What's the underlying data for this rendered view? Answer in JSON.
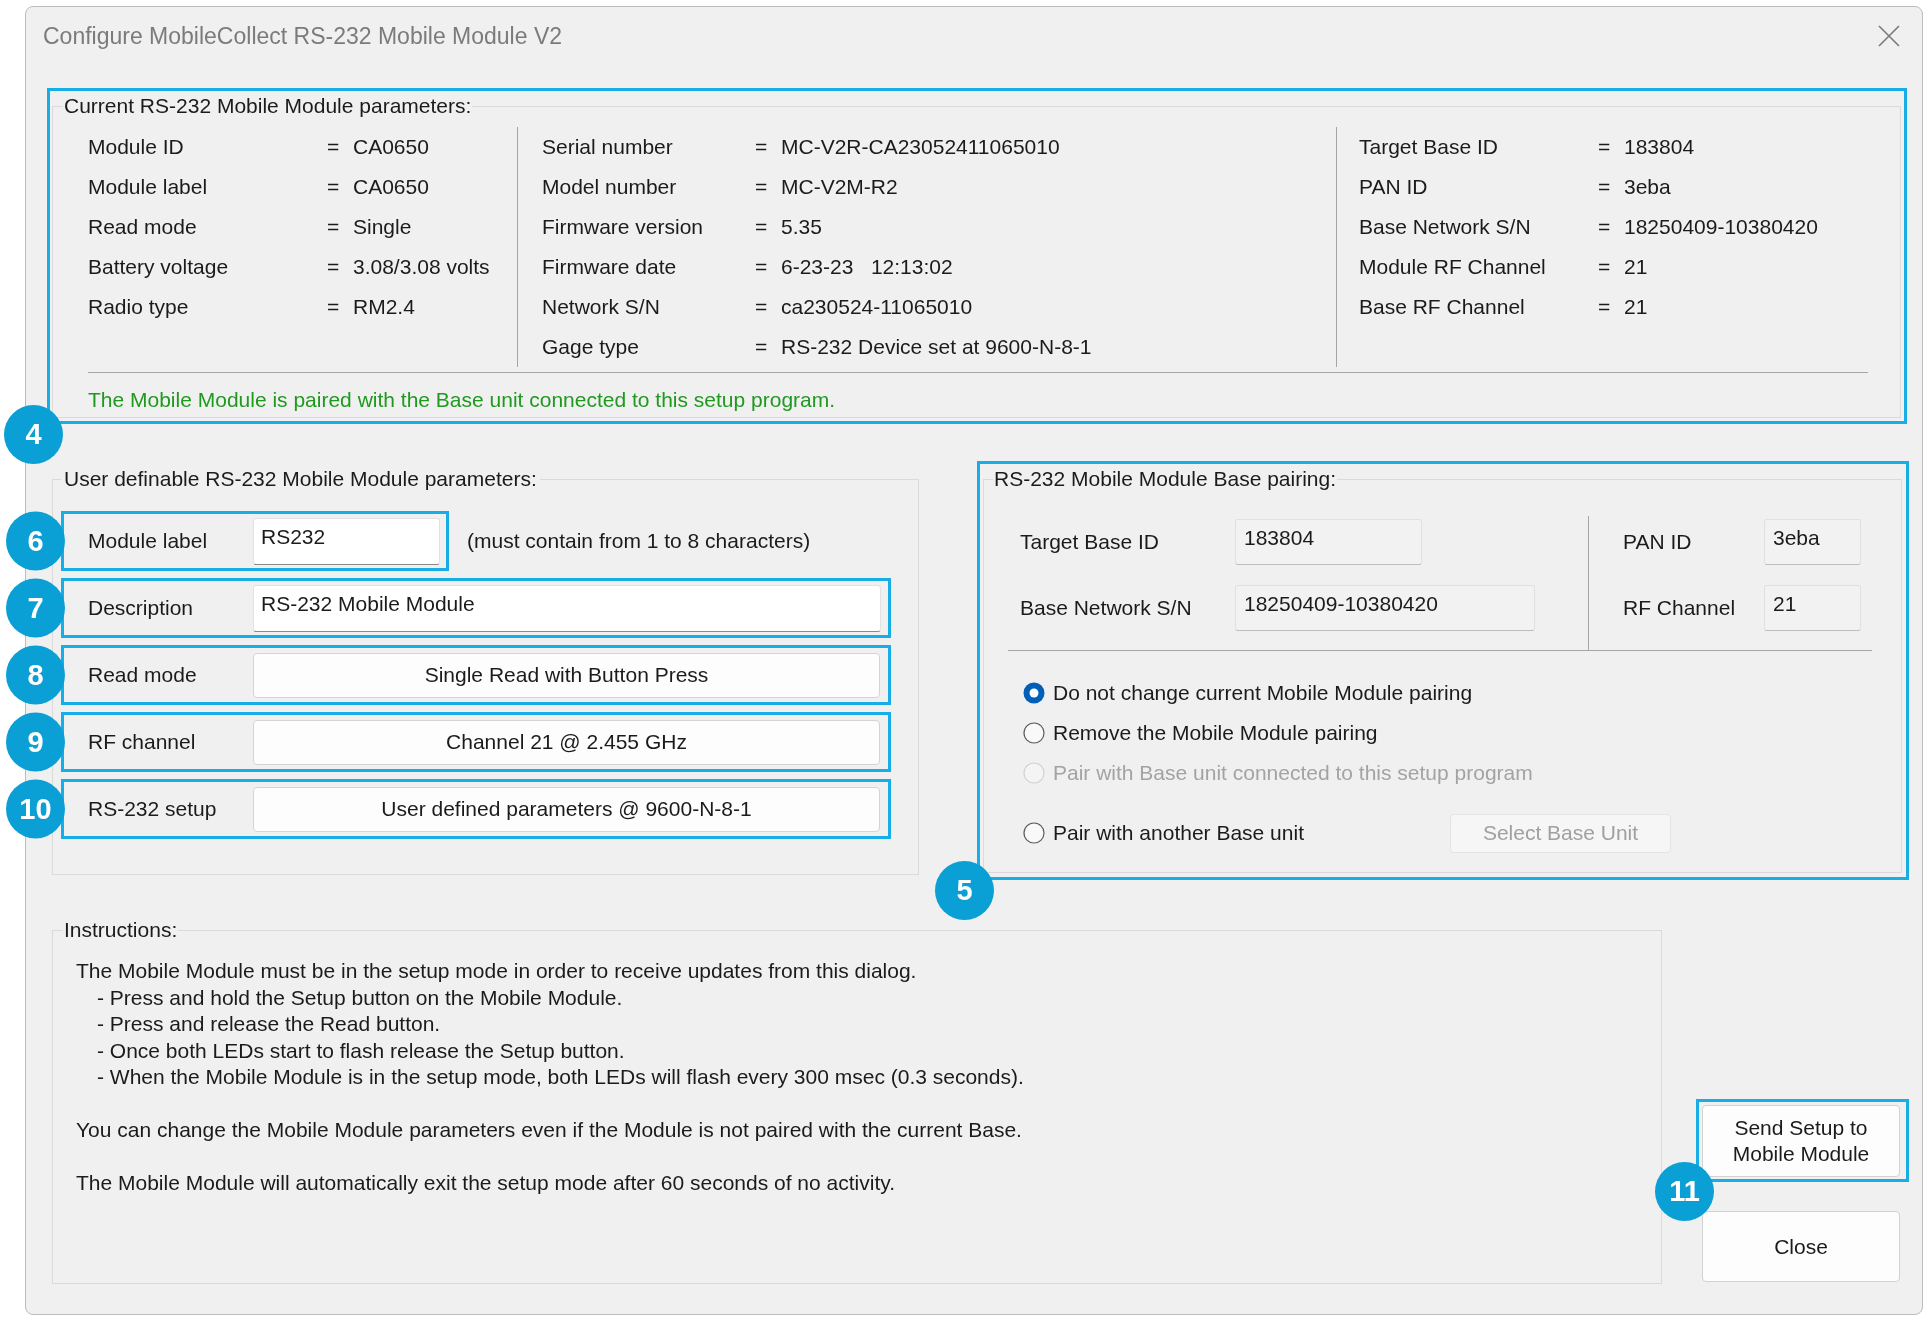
{
  "window": {
    "title": "Configure MobileCollect RS-232 Mobile Module V2"
  },
  "current_parameters": {
    "title": "Current RS-232 Mobile Module parameters:",
    "callout": "4",
    "columns": [
      [
        {
          "label": "Module ID",
          "sep": "=",
          "value": "CA0650"
        },
        {
          "label": "Module label",
          "sep": "=",
          "value": "CA0650"
        },
        {
          "label": "Read mode",
          "sep": "=",
          "value": "Single"
        },
        {
          "label": "Battery voltage",
          "sep": "=",
          "value": "3.08/3.08 volts"
        },
        {
          "label": "Radio type",
          "sep": "=",
          "value": "RM2.4"
        }
      ],
      [
        {
          "label": "Serial number",
          "sep": "=",
          "value": "MC-V2R-CA23052411065010"
        },
        {
          "label": "Model number",
          "sep": "=",
          "value": "MC-V2M-R2"
        },
        {
          "label": "Firmware version",
          "sep": "=",
          "value": "5.35"
        },
        {
          "label": "Firmware date",
          "sep": "=",
          "value": "6-23-23   12:13:02"
        },
        {
          "label": "Network S/N",
          "sep": "=",
          "value": "ca230524-11065010"
        },
        {
          "label": "Gage type",
          "sep": "=",
          "value": "RS-232 Device set at 9600-N-8-1"
        }
      ],
      [
        {
          "label": "Target Base ID",
          "sep": "=",
          "value": "183804"
        },
        {
          "label": "PAN ID",
          "sep": "=",
          "value": "3eba"
        },
        {
          "label": "Base Network S/N",
          "sep": "=",
          "value": "18250409-10380420"
        },
        {
          "label": "Module RF Channel",
          "sep": "=",
          "value": "21"
        },
        {
          "label": "Base RF Channel",
          "sep": "=",
          "value": "21"
        }
      ]
    ],
    "status_message": "The Mobile Module is paired with the Base unit connected to this setup program."
  },
  "user_parameters": {
    "title": "User definable RS-232 Mobile Module parameters:",
    "rows": [
      {
        "kind": "input",
        "label": "Module label",
        "value": "RS232",
        "callout": "6",
        "hint": "(must contain from 1 to 8 characters)"
      },
      {
        "kind": "input",
        "label": "Description",
        "value": "RS-232 Mobile Module",
        "callout": "7"
      },
      {
        "kind": "select",
        "label": "Read mode",
        "value": "Single Read with Button Press",
        "callout": "8"
      },
      {
        "kind": "select",
        "label": "RF channel",
        "value": "Channel 21 @ 2.455 GHz",
        "callout": "9"
      },
      {
        "kind": "select",
        "label": "RS-232 setup",
        "value": "User defined parameters @ 9600-N-8-1",
        "callout": "10"
      }
    ]
  },
  "base_pairing": {
    "title": "RS-232 Mobile Module Base pairing:",
    "callout": "5",
    "fields_left": [
      {
        "label": "Target Base ID",
        "value": "183804"
      },
      {
        "label": "Base Network S/N",
        "value": "18250409-10380420"
      }
    ],
    "fields_right": [
      {
        "label": "PAN ID",
        "value": "3eba"
      },
      {
        "label": "RF Channel",
        "value": "21"
      }
    ],
    "options": [
      {
        "label": "Do not change current Mobile Module pairing",
        "selected": true,
        "disabled": false
      },
      {
        "label": "Remove the Mobile Module pairing",
        "selected": false,
        "disabled": false
      },
      {
        "label": "Pair with Base unit connected to this setup program",
        "selected": false,
        "disabled": true
      },
      {
        "label": "Pair with another Base unit",
        "selected": false,
        "disabled": false,
        "button": {
          "label": "Select Base Unit",
          "disabled": true
        }
      }
    ]
  },
  "instructions": {
    "title": "Instructions:",
    "paragraphs": [
      {
        "text": "The Mobile Module must be in the setup mode in order to receive updates from this dialog.",
        "steps": [
          "- Press and hold the Setup button on the Mobile Module.",
          "- Press and release the Read button.",
          "- Once both LEDs start to flash release the Setup button.",
          "- When the Mobile Module is in the setup mode, both LEDs will flash every 300 msec (0.3 seconds)."
        ]
      },
      {
        "text": "You can change the Mobile Module parameters even if the Module is not paired with the current Base."
      },
      {
        "text": "The Mobile Module will automatically exit the setup mode after 60 seconds of no activity."
      }
    ]
  },
  "buttons": [
    {
      "label": "Send Setup to Mobile Module",
      "callout": "11"
    },
    {
      "label": "Close"
    }
  ]
}
